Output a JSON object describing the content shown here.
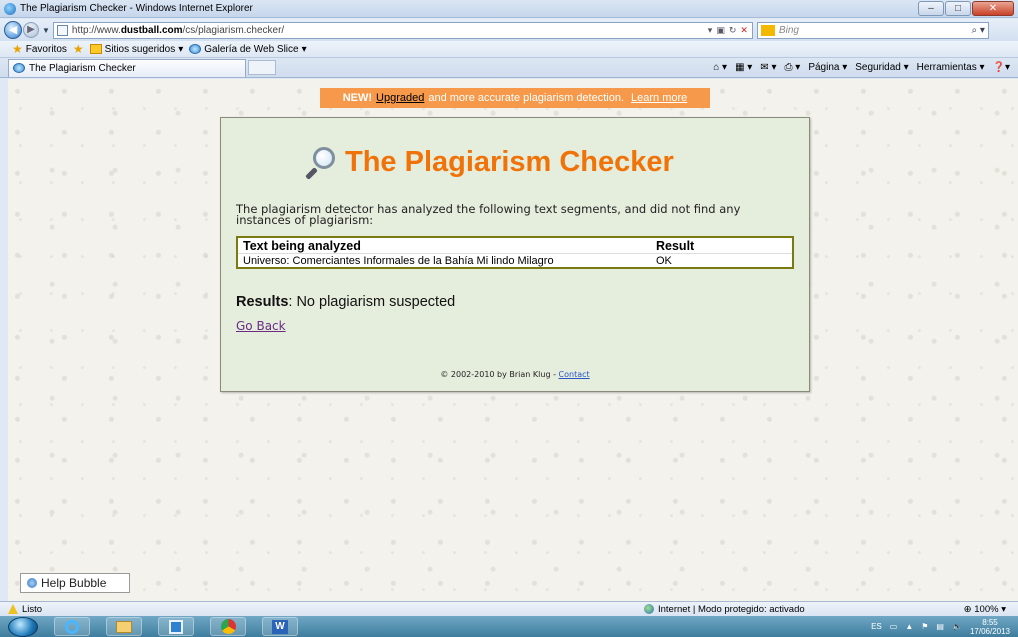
{
  "window": {
    "title": "The Plagiarism Checker - Windows Internet Explorer"
  },
  "address_bar": {
    "url_prefix": "http://www.",
    "url_domain": "dustball.com",
    "url_path": "/cs/plagiarism.checker/",
    "search_placeholder": "Bing"
  },
  "favorites_bar": {
    "favorites_label": "Favoritos",
    "items": [
      "Sitios sugeridos",
      "Galería de Web Slice"
    ]
  },
  "tabs": [
    {
      "label": "The Plagiarism Checker"
    }
  ],
  "command_bar": {
    "items": [
      "Página",
      "Seguridad",
      "Herramientas"
    ]
  },
  "page": {
    "banner": {
      "new_tag": "NEW!",
      "upgraded_link": "Upgraded",
      "text": "and more accurate plagiarism detection.",
      "learn_more": "Learn more"
    },
    "heading": "The Plagiarism Checker",
    "intro_text": "The plagiarism detector has analyzed the following text segments, and did not find any instances of plagiarism:",
    "table": {
      "headers": [
        "Text being analyzed",
        "Result"
      ],
      "rows": [
        {
          "text": "Universo: Comerciantes Informales de la Bahía Mi lindo Milagro",
          "result": "OK"
        }
      ]
    },
    "results": {
      "label": "Results",
      "value": ": No plagiarism suspected"
    },
    "go_back": "Go Back",
    "copyright": "© 2002-2010 by Brian Klug - ",
    "contact": "Contact"
  },
  "help_bubble": "Help Bubble",
  "status_bar": {
    "status": "Listo",
    "zone": "Internet | Modo protegido: activado",
    "zoom": "100%"
  },
  "taskbar": {
    "language": "ES",
    "time": "8:55",
    "date": "17/06/2013"
  }
}
